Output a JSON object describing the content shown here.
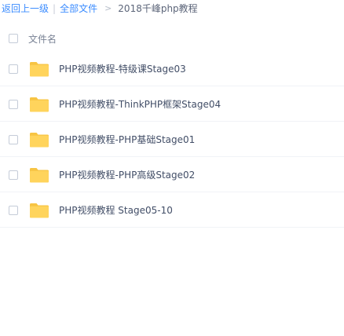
{
  "breadcrumb": {
    "back": "返回上一级",
    "separator": "|",
    "all_files": "全部文件",
    "arrow": ">",
    "current": "2018千峰php教程"
  },
  "list_header": {
    "name_label": "文件名"
  },
  "files": [
    {
      "name": "PHP视频教程-特级课Stage03",
      "icon": "folder-icon"
    },
    {
      "name": "PHP视频教程-ThinkPHP框架Stage04",
      "icon": "folder-icon"
    },
    {
      "name": "PHP视频教程-PHP基础Stage01",
      "icon": "folder-icon"
    },
    {
      "name": "PHP视频教程-PHP高级Stage02",
      "icon": "folder-icon"
    },
    {
      "name": "PHP视频教程 Stage05-10",
      "icon": "folder-icon"
    }
  ],
  "colors": {
    "link": "#3b8cff",
    "folder": "#ffd45c",
    "folder_tab": "#f7c443"
  }
}
